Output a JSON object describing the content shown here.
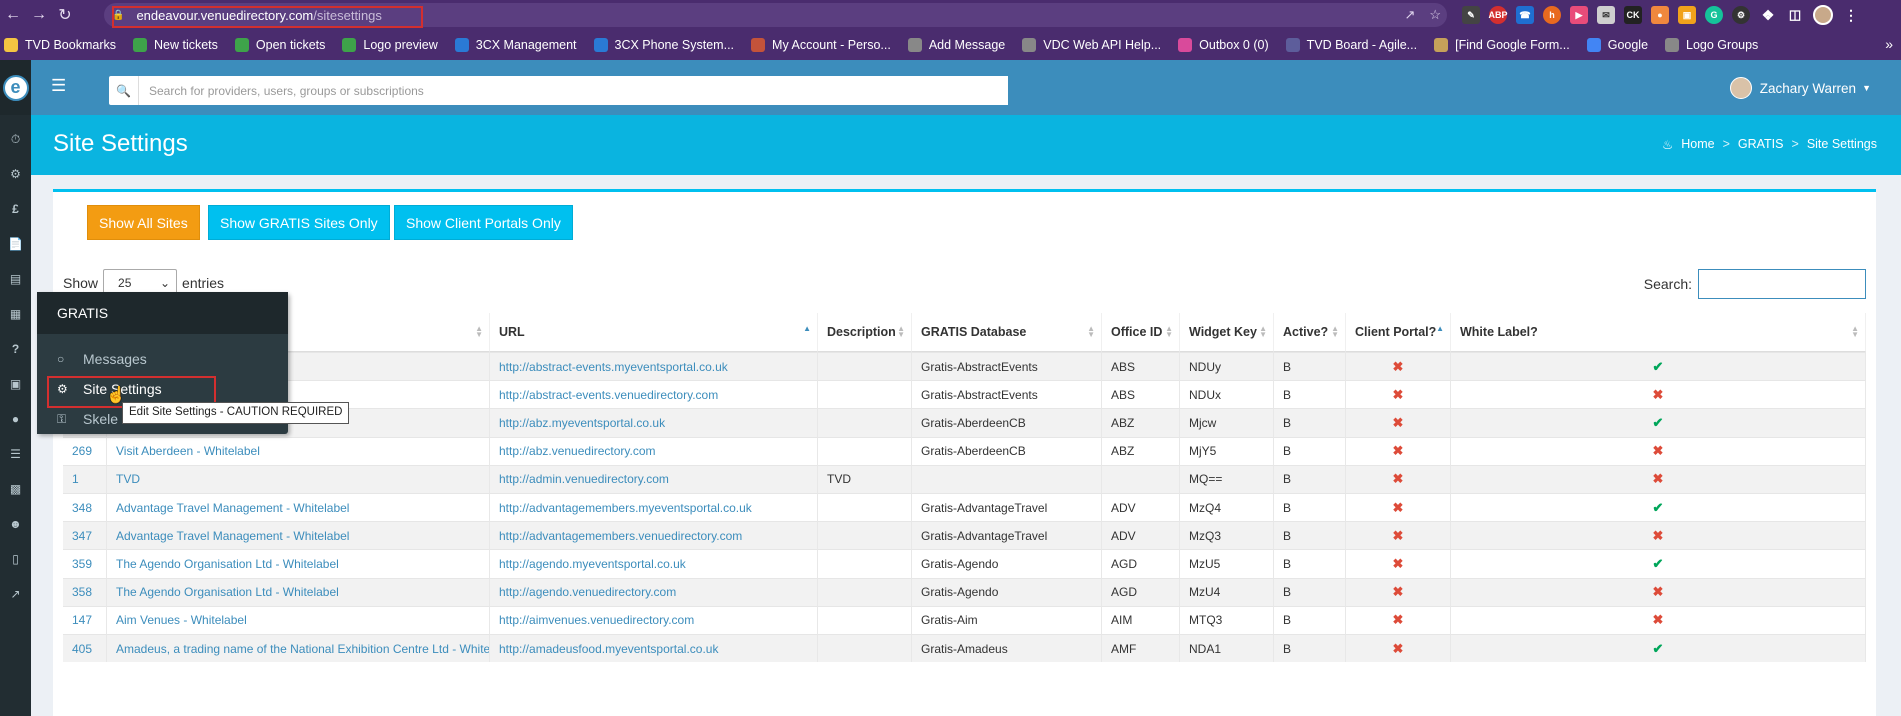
{
  "browser": {
    "url_host": "endeavour.venuedirectory.com",
    "url_path": "/sitesettings"
  },
  "bookmarks": [
    {
      "label": "TVD Bookmarks",
      "icon": "folder-icon",
      "color": "#f4c542"
    },
    {
      "label": "New tickets",
      "icon": "ticket-icon",
      "color": "#3ea34a"
    },
    {
      "label": "Open tickets",
      "icon": "ticket-icon",
      "color": "#3ea34a"
    },
    {
      "label": "Logo preview",
      "icon": "ticket-icon",
      "color": "#3ea34a"
    },
    {
      "label": "3CX Management",
      "icon": "3cx-icon",
      "color": "#2a7ad5"
    },
    {
      "label": "3CX Phone System...",
      "icon": "3cx-icon",
      "color": "#2a7ad5"
    },
    {
      "label": "My Account - Perso...",
      "icon": "account-icon",
      "color": "#c4533a"
    },
    {
      "label": "Add Message",
      "icon": "message-icon",
      "color": "#888888"
    },
    {
      "label": "VDC Web API Help...",
      "icon": "globe-icon",
      "color": "#888888"
    },
    {
      "label": "Outbox 0 (0)",
      "icon": "outbox-icon",
      "color": "#d94a9b"
    },
    {
      "label": "TVD Board - Agile...",
      "icon": "board-icon",
      "color": "#5d5d9b"
    },
    {
      "label": "[Find Google Form...",
      "icon": "form-icon",
      "color": "#c6a15a"
    },
    {
      "label": "Google",
      "icon": "google-icon",
      "color": "#4285f4"
    },
    {
      "label": "Logo Groups",
      "icon": "globe-icon",
      "color": "#888888"
    }
  ],
  "header": {
    "search_placeholder": "Search for providers, users, groups or subscriptions",
    "user_name": "Zachary Warren"
  },
  "page": {
    "title": "Site Settings",
    "breadcrumb": [
      "Home",
      "GRATIS",
      "Site Settings"
    ]
  },
  "filters": {
    "all": "Show All Sites",
    "gratis": "Show GRATIS Sites Only",
    "client": "Show Client Portals Only"
  },
  "table_controls": {
    "show_label": "Show",
    "page_size": "25",
    "entries_label": "entries",
    "search_label": "Search:"
  },
  "columns": [
    "URL",
    "Description",
    "GRATIS Database",
    "Office ID",
    "Widget Key",
    "Active?",
    "Client Portal?",
    "White Label?"
  ],
  "rows": [
    {
      "id": "",
      "name": "",
      "url": "http://abstract-events.myeventsportal.co.uk",
      "desc": "",
      "db": "Gratis-AbstractEvents",
      "office": "ABS",
      "key": "NDUy",
      "active": "B",
      "client": false,
      "white": true
    },
    {
      "id": "",
      "name": "",
      "url": "http://abstract-events.venuedirectory.com",
      "desc": "",
      "db": "Gratis-AbstractEvents",
      "office": "ABS",
      "key": "NDUx",
      "active": "B",
      "client": false,
      "white": false
    },
    {
      "id": "",
      "name": "",
      "url": "http://abz.myeventsportal.co.uk",
      "desc": "",
      "db": "Gratis-AberdeenCB",
      "office": "ABZ",
      "key": "Mjcw",
      "active": "B",
      "client": false,
      "white": true
    },
    {
      "id": "269",
      "name": "Visit Aberdeen - Whitelabel",
      "url": "http://abz.venuedirectory.com",
      "desc": "",
      "db": "Gratis-AberdeenCB",
      "office": "ABZ",
      "key": "MjY5",
      "active": "B",
      "client": false,
      "white": false
    },
    {
      "id": "1",
      "name": "TVD",
      "url": "http://admin.venuedirectory.com",
      "desc": "TVD",
      "db": "",
      "office": "",
      "key": "MQ==",
      "active": "B",
      "client": false,
      "white": false
    },
    {
      "id": "348",
      "name": "Advantage Travel Management - Whitelabel",
      "url": "http://advantagemembers.myeventsportal.co.uk",
      "desc": "",
      "db": "Gratis-AdvantageTravel",
      "office": "ADV",
      "key": "MzQ4",
      "active": "B",
      "client": false,
      "white": true
    },
    {
      "id": "347",
      "name": "Advantage Travel Management - Whitelabel",
      "url": "http://advantagemembers.venuedirectory.com",
      "desc": "",
      "db": "Gratis-AdvantageTravel",
      "office": "ADV",
      "key": "MzQ3",
      "active": "B",
      "client": false,
      "white": false
    },
    {
      "id": "359",
      "name": "The Agendo Organisation Ltd - Whitelabel",
      "url": "http://agendo.myeventsportal.co.uk",
      "desc": "",
      "db": "Gratis-Agendo",
      "office": "AGD",
      "key": "MzU5",
      "active": "B",
      "client": false,
      "white": true
    },
    {
      "id": "358",
      "name": "The Agendo Organisation Ltd - Whitelabel",
      "url": "http://agendo.venuedirectory.com",
      "desc": "",
      "db": "Gratis-Agendo",
      "office": "AGD",
      "key": "MzU4",
      "active": "B",
      "client": false,
      "white": false
    },
    {
      "id": "147",
      "name": "Aim Venues - Whitelabel",
      "url": "http://aimvenues.venuedirectory.com",
      "desc": "",
      "db": "Gratis-Aim",
      "office": "AIM",
      "key": "MTQ3",
      "active": "B",
      "client": false,
      "white": false
    },
    {
      "id": "405",
      "name": "Amadeus, a trading name of the National Exhibition Centre Ltd - Whitelabel",
      "url": "http://amadeusfood.myeventsportal.co.uk",
      "desc": "",
      "db": "Gratis-Amadeus",
      "office": "AMF",
      "key": "NDA1",
      "active": "B",
      "client": false,
      "white": true
    }
  ],
  "flyout": {
    "heading": "GRATIS",
    "items": [
      "Messages",
      "Site Settings",
      "Skele"
    ]
  },
  "tooltip": "Edit Site Settings - CAUTION REQUIRED",
  "colors": {
    "accent": "#3c8dbc",
    "titlebar": "#0ab4e0",
    "orange": "#f39c12",
    "cyan": "#00c0ef",
    "sidebar": "#222d32"
  }
}
